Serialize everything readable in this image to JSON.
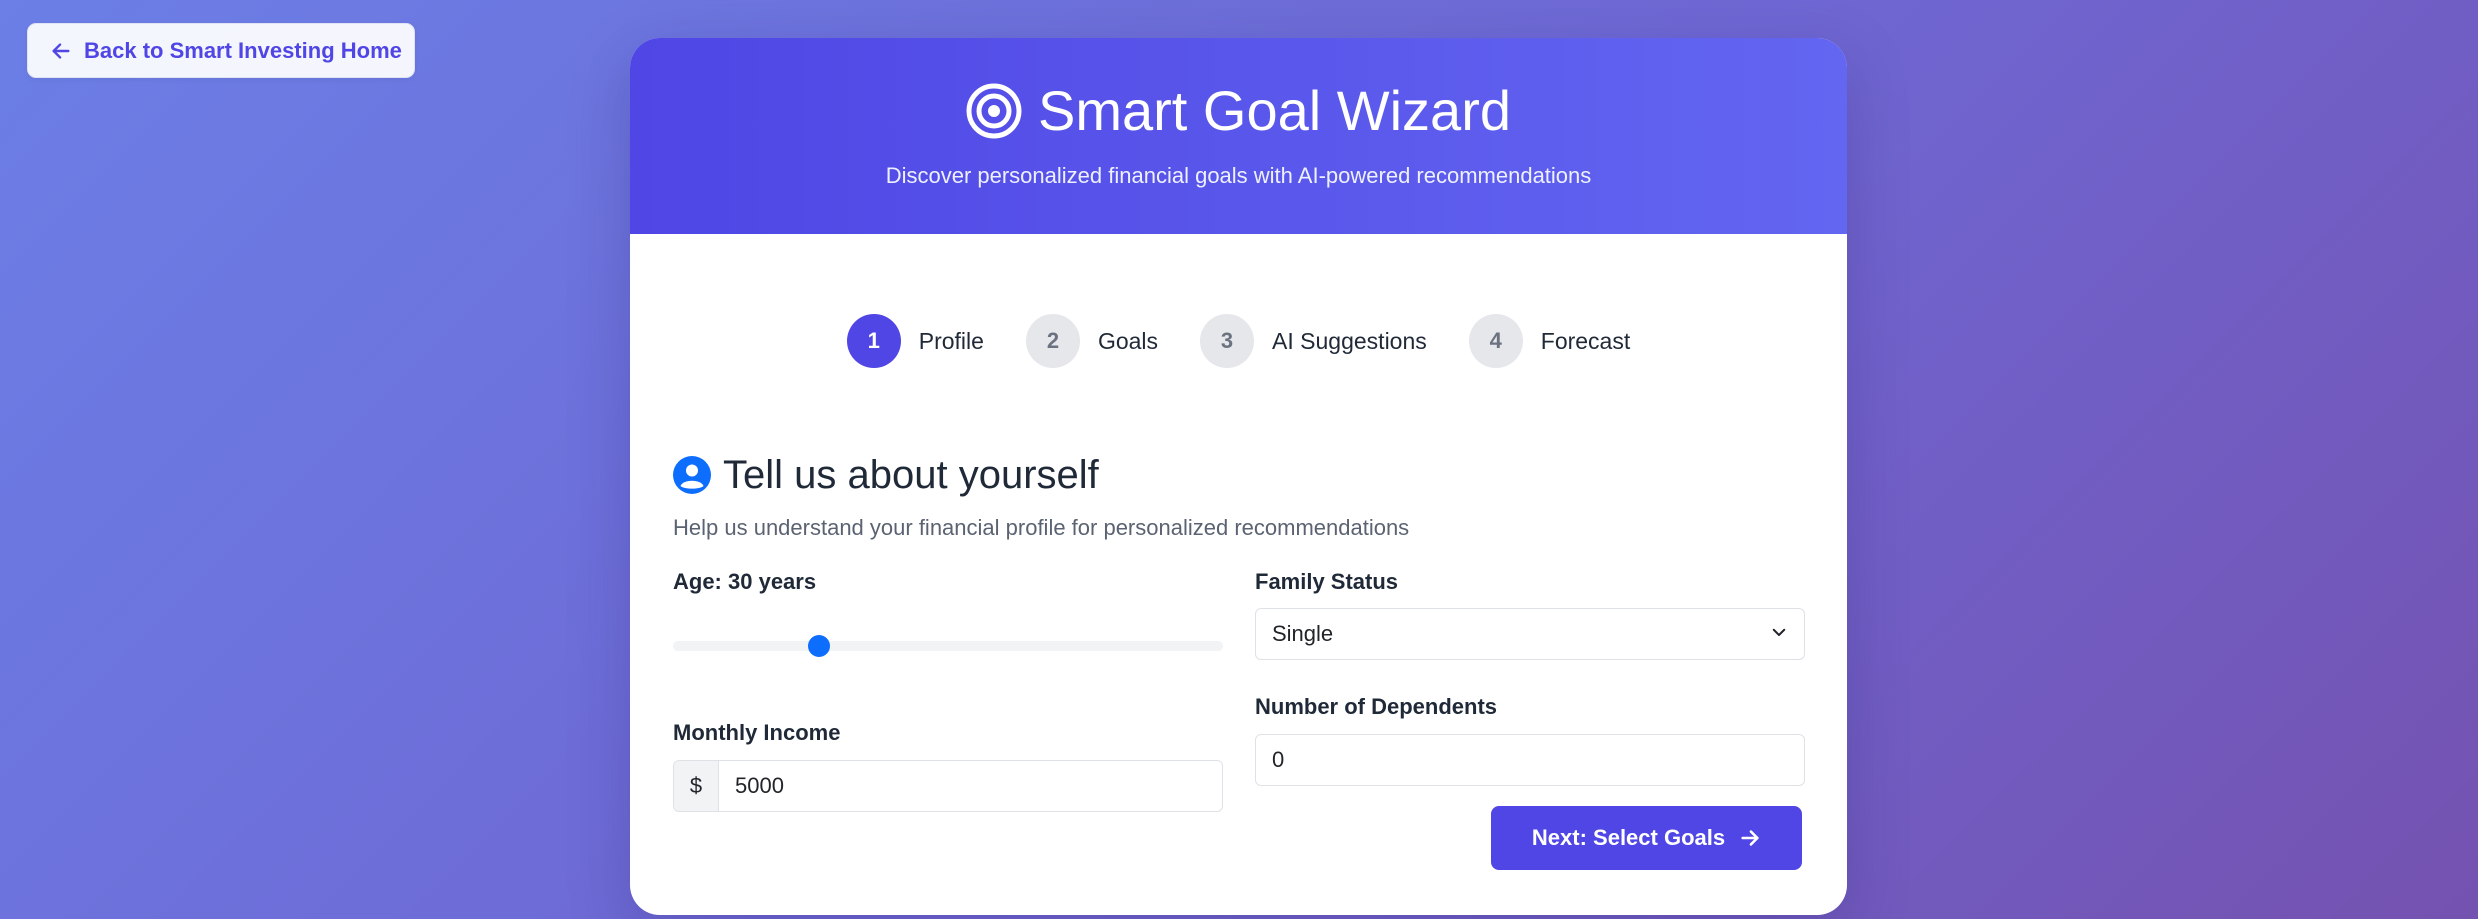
{
  "nav": {
    "back_label": "Back to Smart Investing Home"
  },
  "header": {
    "title": "Smart Goal Wizard",
    "subtitle": "Discover personalized financial goals with AI-powered recommendations"
  },
  "steps": [
    {
      "number": "1",
      "label": "Profile",
      "active": true
    },
    {
      "number": "2",
      "label": "Goals",
      "active": false
    },
    {
      "number": "3",
      "label": "AI Suggestions",
      "active": false
    },
    {
      "number": "4",
      "label": "Forecast",
      "active": false
    }
  ],
  "profile": {
    "title": "Tell us about yourself",
    "description": "Help us understand your financial profile for personalized recommendations",
    "age": {
      "label": "Age: 30 years",
      "value": 30,
      "slider_fraction": 0.265
    },
    "family_status": {
      "label": "Family Status",
      "selected": "Single"
    },
    "monthly_income": {
      "label": "Monthly Income",
      "prefix": "$",
      "value": "5000"
    },
    "dependents": {
      "label": "Number of Dependents",
      "value": "0"
    }
  },
  "actions": {
    "next_label": "Next: Select Goals"
  },
  "colors": {
    "primary": "#4f46e5",
    "slider": "#0d6efd",
    "step_inactive": "#e5e7eb"
  },
  "icons": {
    "back": "arrow-left-icon",
    "title": "bullseye-icon",
    "section": "user-circle-icon",
    "select": "chevron-down-icon",
    "next": "arrow-right-icon"
  }
}
